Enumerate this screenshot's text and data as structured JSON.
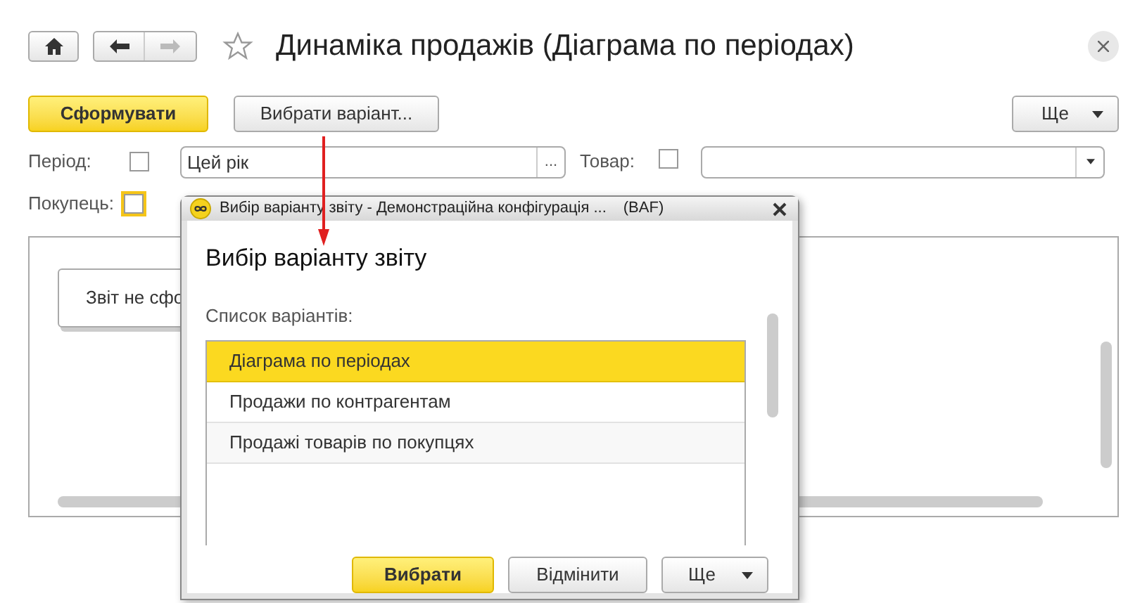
{
  "title": "Динаміка продажів (Діаграма по періодах)",
  "toolbar": {
    "generate": "Сформувати",
    "choose_variant": "Вибрати варіант...",
    "more": "Ще"
  },
  "filters": [
    {
      "label": "Період:",
      "checked": false,
      "focused": false,
      "value": "Цей рік",
      "kind": "ellipsis",
      "button": "..."
    },
    {
      "label": "Товар:",
      "checked": false,
      "focused": false,
      "kind": "dropdown"
    },
    {
      "label": "Покупець:",
      "checked": false,
      "focused": true
    }
  ],
  "report": {
    "message": "Звіт не сфо"
  },
  "dialog": {
    "window_title": "Вибір варіанту звіту - Демонстраційна конфігурація ...",
    "window_suffix": "(BAF)",
    "heading": "Вибір варіанту звіту",
    "list_label": "Список варіантів:",
    "variants": [
      {
        "label": "Діаграма по періодах",
        "selected": true
      },
      {
        "label": "Продажи по контрагентам",
        "selected": false
      },
      {
        "label": "Продажі товарів по покупцях",
        "selected": false
      }
    ],
    "buttons": {
      "ok": "Вибрати",
      "cancel": "Відмінити",
      "more": "Ще"
    }
  }
}
